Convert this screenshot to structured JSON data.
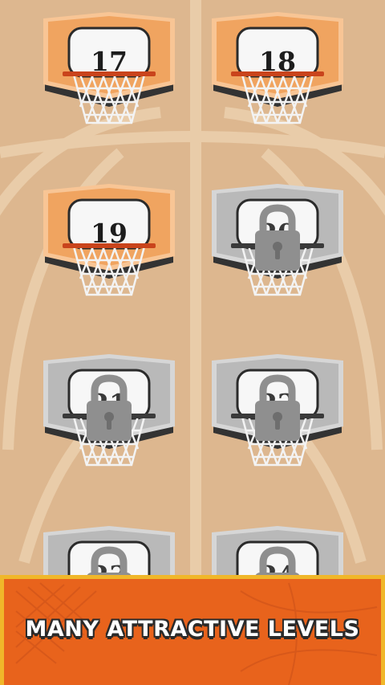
{
  "colors": {
    "background": "#ddb78f",
    "court_lines": "#e9cca9",
    "unlocked_board": "#f0a460",
    "unlocked_trim": "#f8c595",
    "locked_board": "#b9b9b9",
    "locked_trim": "#d6d6d6",
    "board_shadow": "#333333",
    "rim": "#c9441c",
    "lock": "#8f8f8f",
    "banner": "#e8631c",
    "banner_border": "#f0b72a"
  },
  "levels": [
    {
      "number": "17",
      "locked": false
    },
    {
      "number": "18",
      "locked": false
    },
    {
      "number": "19",
      "locked": false
    },
    {
      "number": "20",
      "locked": true,
      "icon": "padlock-icon"
    },
    {
      "number": "21",
      "locked": true,
      "icon": "padlock-icon"
    },
    {
      "number": "22",
      "locked": true,
      "icon": "padlock-icon"
    },
    {
      "number": "23",
      "locked": true,
      "icon": "padlock-icon"
    },
    {
      "number": "24",
      "locked": true,
      "icon": "padlock-icon"
    }
  ],
  "banner": {
    "text": "MANY ATTRACTIVE LEVELS"
  }
}
